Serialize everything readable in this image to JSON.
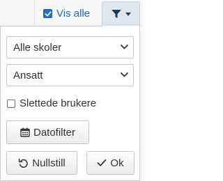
{
  "toolbar": {
    "show_all_label": "Vis alle",
    "show_all_checked": true,
    "filter_icon": "filter-icon",
    "caret_icon": "caret-down-icon"
  },
  "panel": {
    "school_select": {
      "value": "Alle skoler"
    },
    "role_select": {
      "value": "Ansatt"
    },
    "deleted_users": {
      "label": "Slettede brukere",
      "checked": false
    },
    "date_filter_label": "Datofilter",
    "date_filter_icon": "calendar-icon",
    "reset_label": "Nullstill",
    "reset_icon": "undo-icon",
    "ok_label": "Ok",
    "ok_icon": "check-icon"
  },
  "colors": {
    "accent": "#1b68c9",
    "filter_button_bg": "#dfe6ee",
    "icon_dark": "#1f3b5a"
  }
}
